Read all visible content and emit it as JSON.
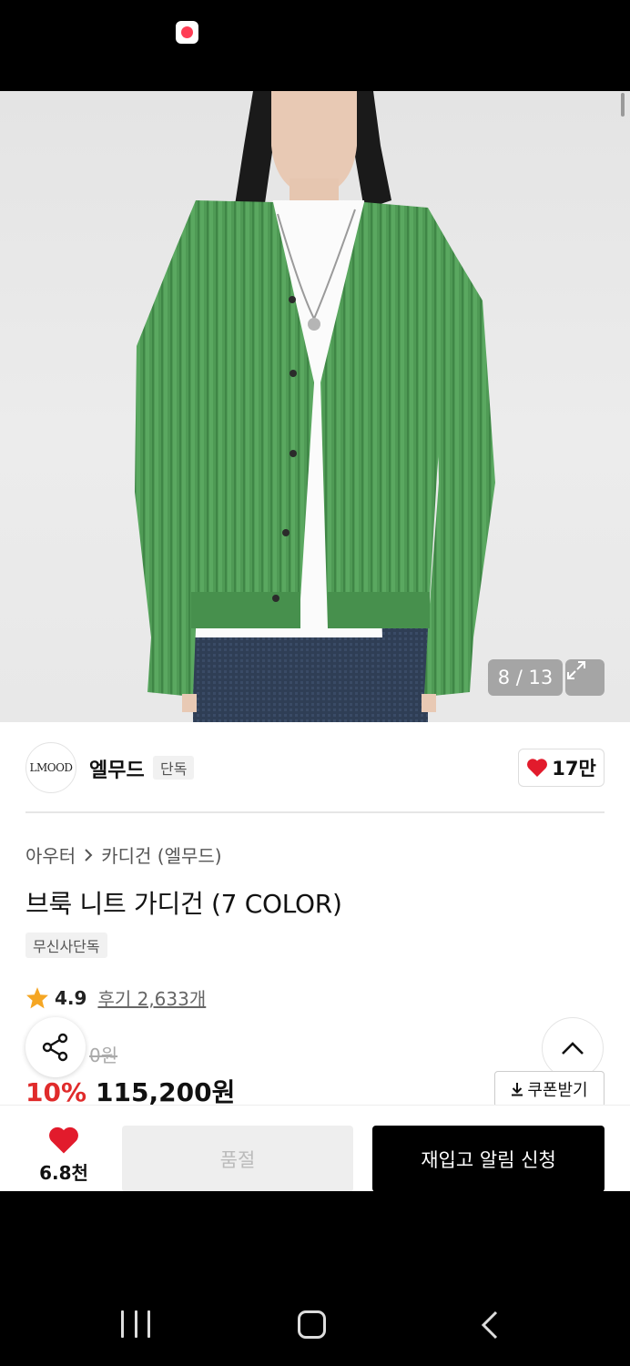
{
  "status_bar": {
    "notification_icon": "notification-app-icon"
  },
  "hero": {
    "counter": "8 / 13",
    "expand_icon": "expand-icon",
    "colors": {
      "knit": "#4f9a55",
      "shirt": "#ffffff",
      "jeans": "#2f3e55",
      "background": "#e8e8e8"
    }
  },
  "brand": {
    "logo_text": "LMOOD",
    "name": "엘무드",
    "badge": "단독",
    "likes": "17만"
  },
  "breadcrumb": {
    "category": "아우터",
    "subcategory": "카디건 (엘무드)"
  },
  "product": {
    "title": "브룩 니트 가디건 (7 COLOR)",
    "tag": "무신사단독",
    "rating": "4.9",
    "reviews": "후기 2,633개",
    "original_price_visible": "0원",
    "discount": "10%",
    "price": "115,200원"
  },
  "actions": {
    "coupon_label": "쿠폰받기",
    "favorite_count": "6.8천",
    "soldout_label": "품절",
    "restock_label": "재입고 알림 신청"
  },
  "colors": {
    "accent_red": "#e02b2b",
    "primary_black": "#000000"
  }
}
